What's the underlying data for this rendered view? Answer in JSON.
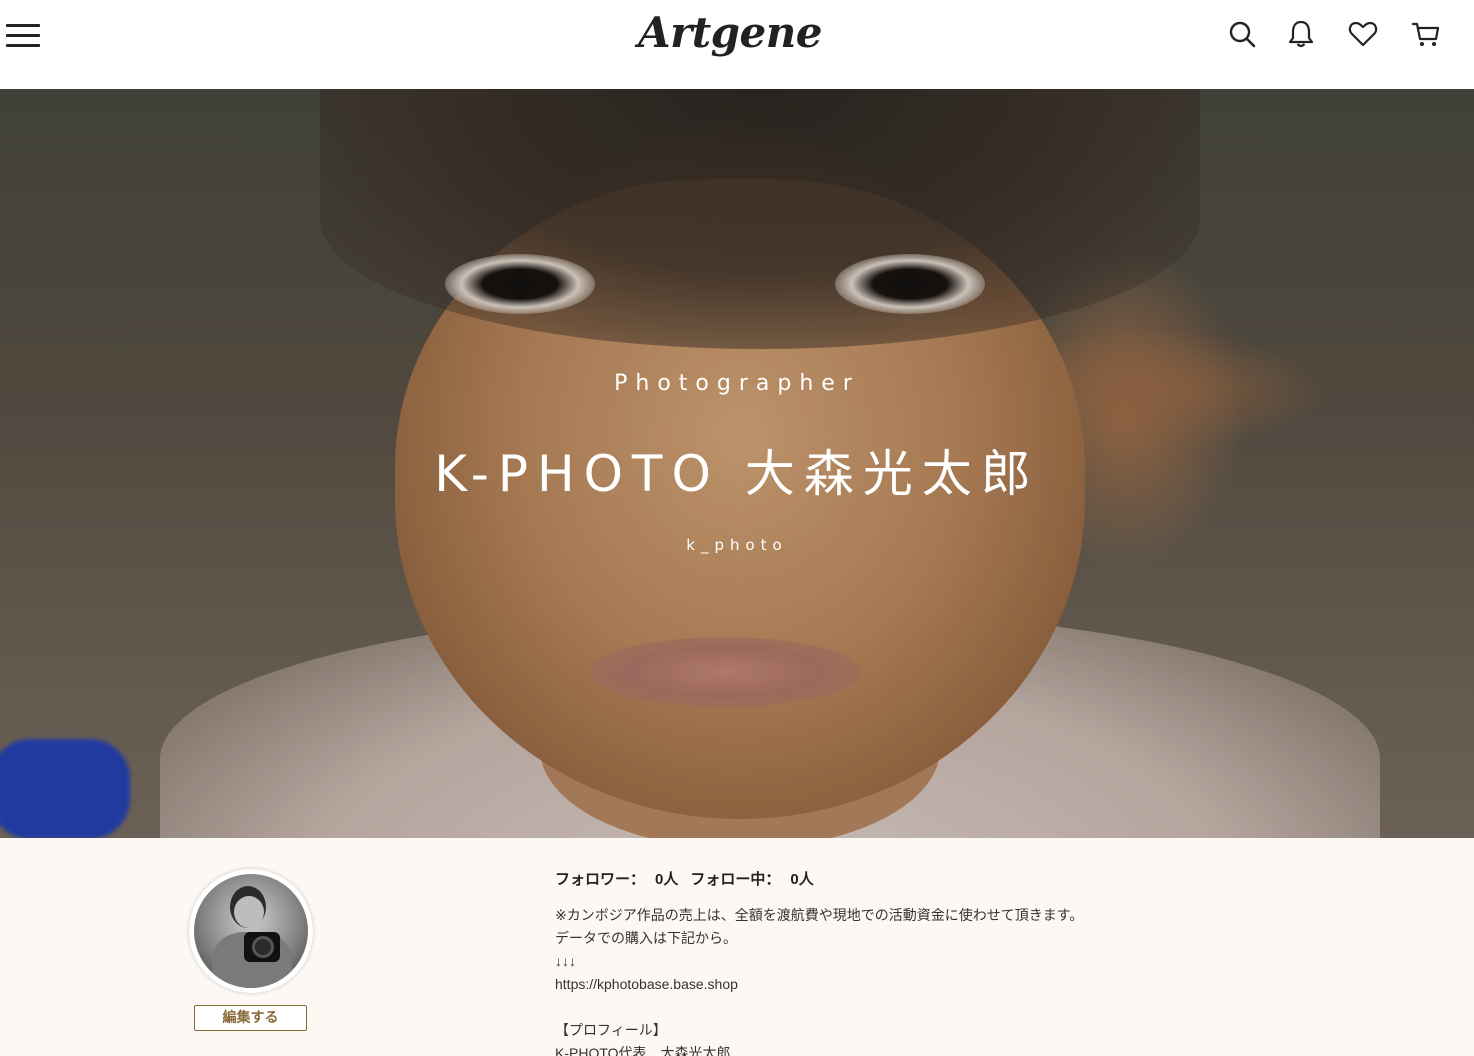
{
  "header": {
    "logo": "Artgene",
    "icons": [
      "menu-icon",
      "search-icon",
      "bell-icon",
      "heart-icon",
      "cart-icon"
    ]
  },
  "hero": {
    "role": "Photographer",
    "name": "K-PHOTO 大森光太郎",
    "handle": "k_photo"
  },
  "profile": {
    "edit_label": "編集する",
    "followers_label": "フォロワー：",
    "followers_count": "0人",
    "following_label": "フォロー中：",
    "following_count": "0人",
    "bio": {
      "line1": "※カンボジア作品の売上は、全額を渡航費や現地での活動資金に使わせて頂きます。",
      "line2": "データでの購入は下記から。",
      "line3": "↓↓↓",
      "link": "https://kphotobase.base.shop",
      "line5": "【プロフィール】",
      "line6": "K-PHOTO代表　大森光太郎"
    }
  },
  "colors": {
    "header_bg": "#ffffff",
    "page_bg": "#fdf8f3",
    "accent": "#8b6a3c"
  }
}
